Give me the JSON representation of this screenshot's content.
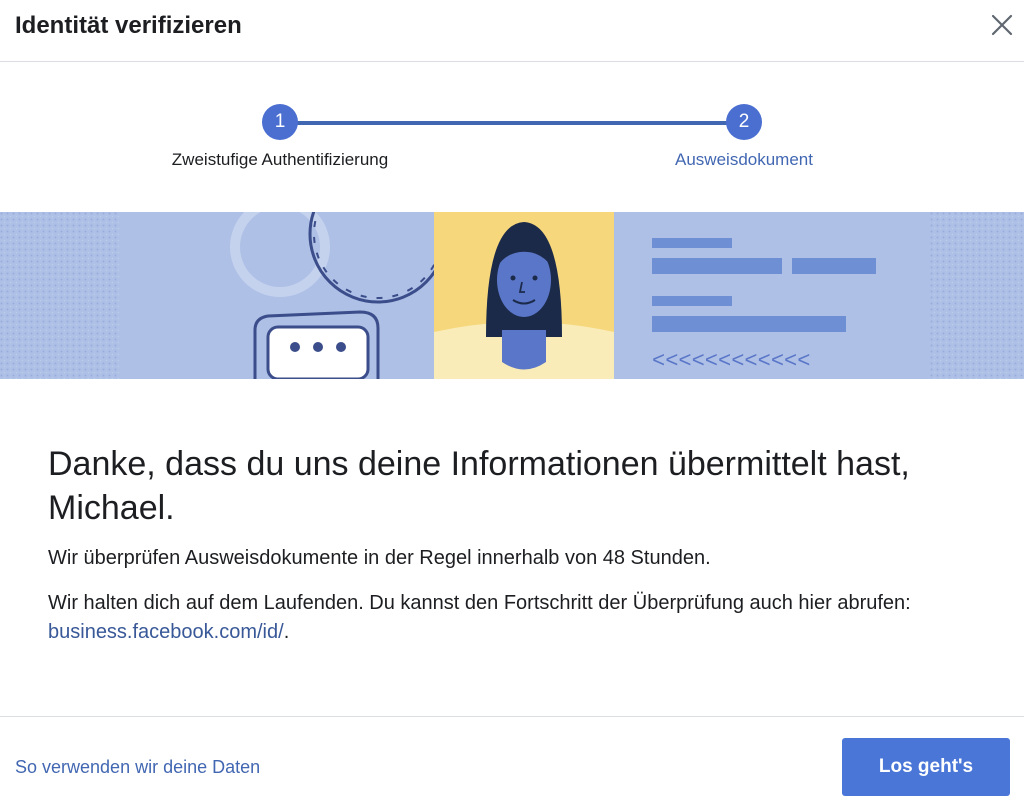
{
  "header": {
    "title": "Identität verifizieren"
  },
  "stepper": {
    "steps": [
      {
        "number": "1",
        "label": "Zweistufige Authentifizierung"
      },
      {
        "number": "2",
        "label": "Ausweisdokument"
      }
    ]
  },
  "banner": {
    "mrz_text": "<<<<<<<<<<<<"
  },
  "content": {
    "heading": "Danke, dass du uns deine Informationen übermittelt hast, Michael.",
    "paragraph1": "Wir überprüfen Ausweisdokumente in der Regel innerhalb von 48 Stunden.",
    "paragraph2_before": "Wir halten dich auf dem Laufenden. Du kannst den Fortschritt der Überprüfung auch hier abrufen: ",
    "paragraph2_link": "business.facebook.com/id/",
    "paragraph2_after": "."
  },
  "footer": {
    "data_link": "So verwenden wir deine Daten",
    "primary_button": "Los geht's"
  },
  "colors": {
    "accent": "#4267b2",
    "button": "#4a76d8",
    "banner_blue": "#a9bde6",
    "banner_yellow": "#f6d77b"
  }
}
